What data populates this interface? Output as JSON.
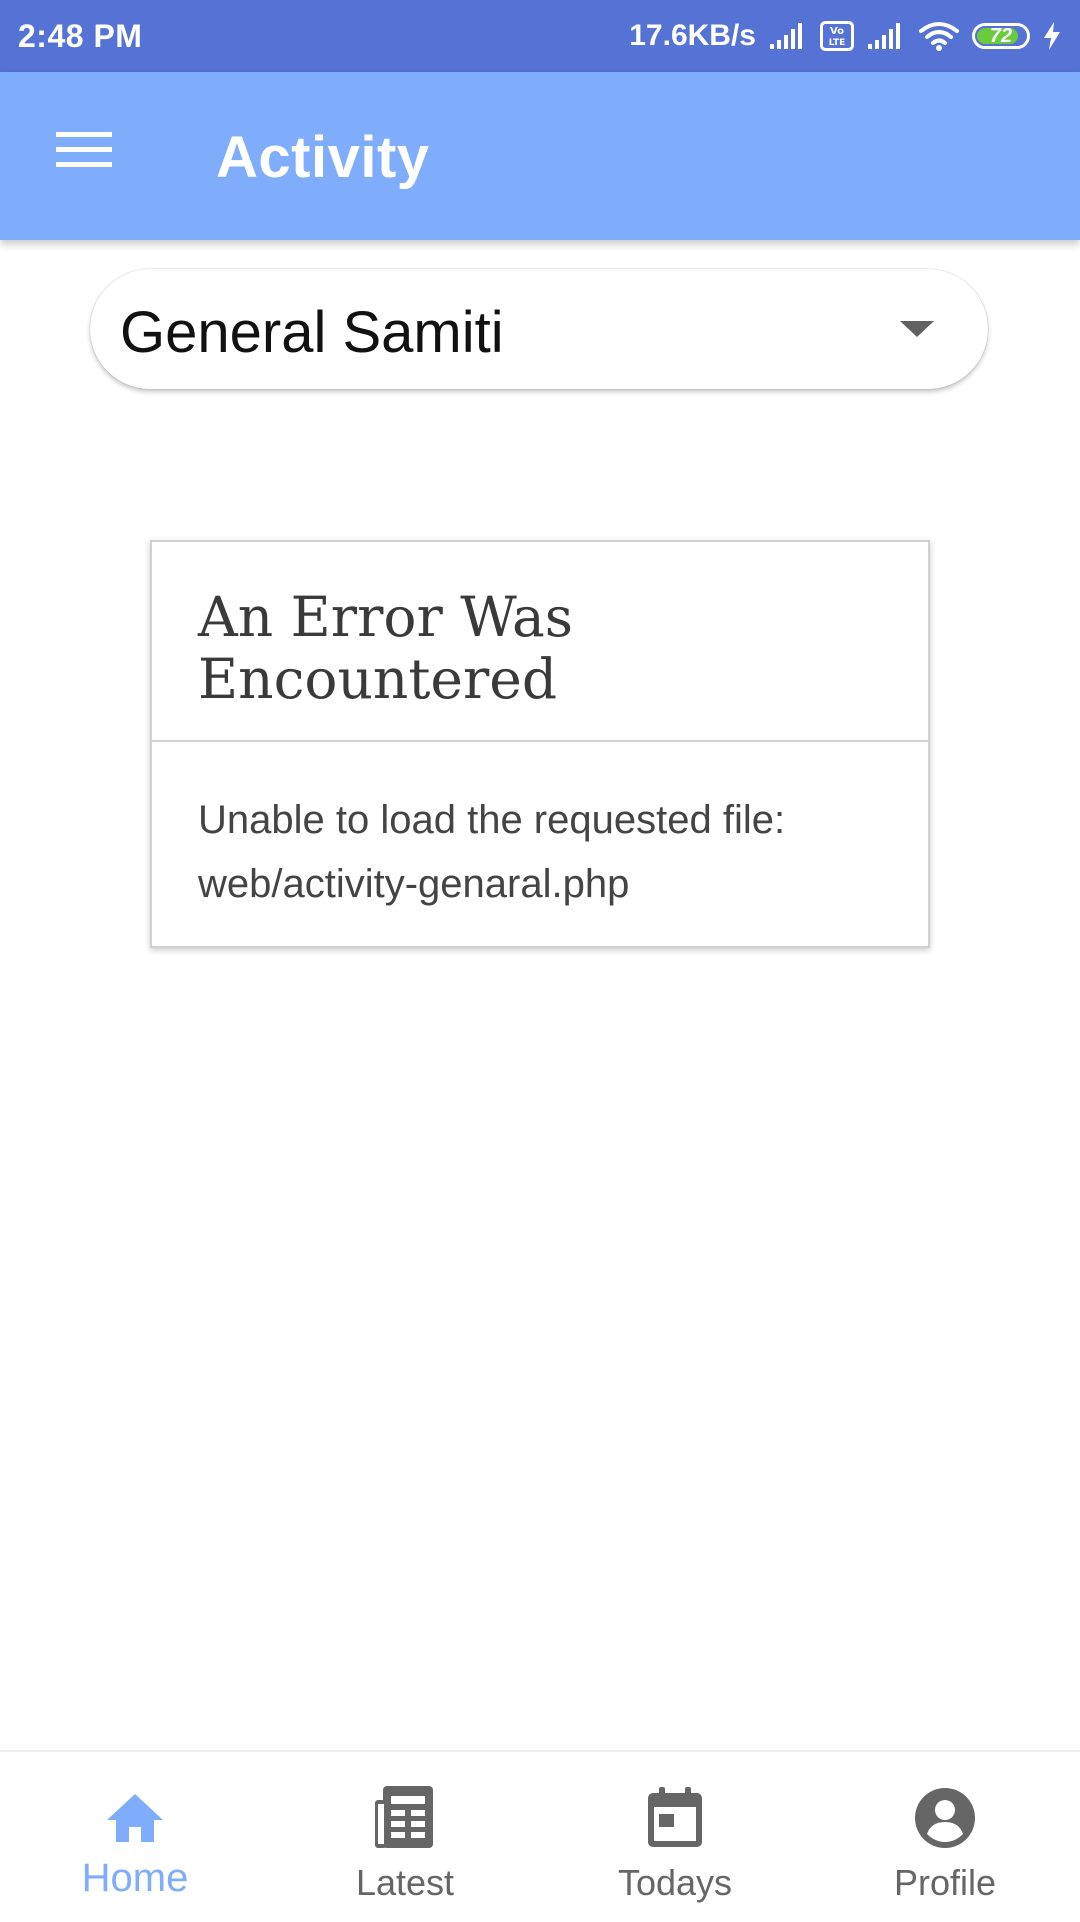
{
  "status_bar": {
    "time": "2:48 PM",
    "speed": "17.6KB/s",
    "battery_level": "72",
    "icons": [
      "signal-icon",
      "volte-icon",
      "signal-icon",
      "wifi-icon",
      "battery-icon",
      "charging-icon"
    ]
  },
  "app_bar": {
    "title": "Activity",
    "menu_icon": "menu-icon"
  },
  "dropdown": {
    "selected": "General Samiti"
  },
  "error": {
    "title": "An Error Was Encountered",
    "message_line1": "Unable to load the requested file:",
    "message_line2": "web/activity-genaral.php"
  },
  "bottom_nav": {
    "active_color": "#7FADFC",
    "items": [
      {
        "label": "Home",
        "icon": "home-icon",
        "active": true
      },
      {
        "label": "Latest",
        "icon": "newspaper-icon",
        "active": false
      },
      {
        "label": "Todays",
        "icon": "calendar-icon",
        "active": false
      },
      {
        "label": "Profile",
        "icon": "account-icon",
        "active": false
      }
    ]
  },
  "colors": {
    "status_bar": "#5573D4",
    "app_bar": "#7FADFC",
    "battery_fill": "#6ACB3C"
  }
}
